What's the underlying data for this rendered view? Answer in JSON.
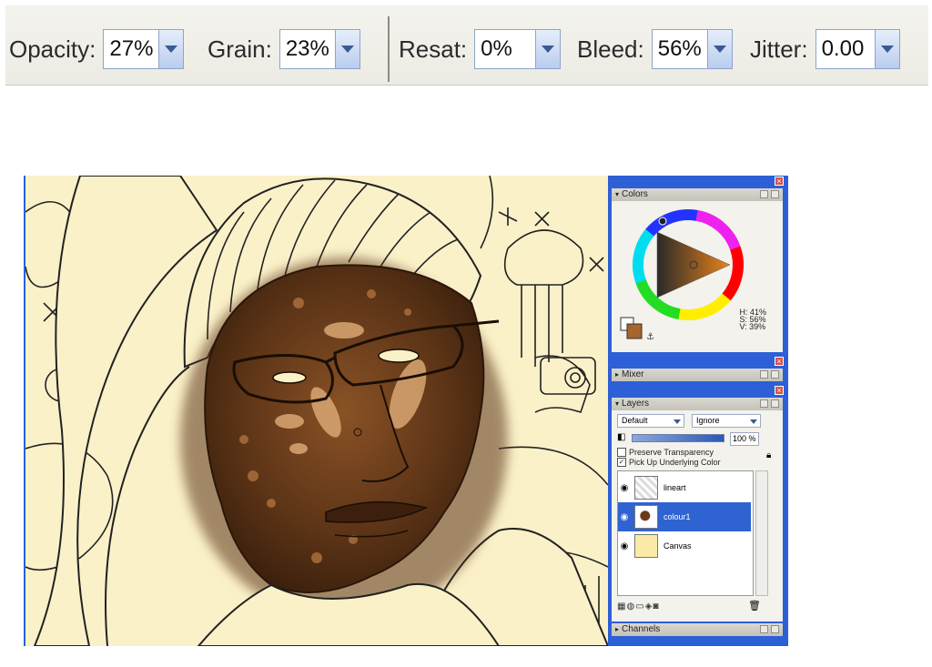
{
  "property_bar": {
    "opacity": {
      "label": "Opacity:",
      "value": "27%"
    },
    "grain": {
      "label": "Grain:",
      "value": "23%"
    },
    "resat": {
      "label": "Resat:",
      "value": "0%"
    },
    "bleed": {
      "label": "Bleed:",
      "value": "56%"
    },
    "jitter": {
      "label": "Jitter:",
      "value": "0.00"
    }
  },
  "colors_panel": {
    "title": "Colors",
    "h": "H: 41%",
    "s": "S: 56%",
    "v": "V: 39%",
    "main_color": "#a5652b"
  },
  "mixer_panel": {
    "title": "Mixer"
  },
  "layers_panel": {
    "title": "Layers",
    "composite_method": "Default",
    "composite_depth": "Ignore",
    "opacity_value": "100",
    "opacity_unit": "%",
    "preserve_transparency": "Preserve Transparency",
    "pick_up_underlying": "Pick Up Underlying Color",
    "layers": [
      {
        "name": "lineart"
      },
      {
        "name": "colour1"
      },
      {
        "name": "Canvas"
      }
    ]
  },
  "channels_panel": {
    "title": "Channels"
  },
  "colors": {
    "accent": "#2d5fd6",
    "paper": "#fbf1c9"
  }
}
